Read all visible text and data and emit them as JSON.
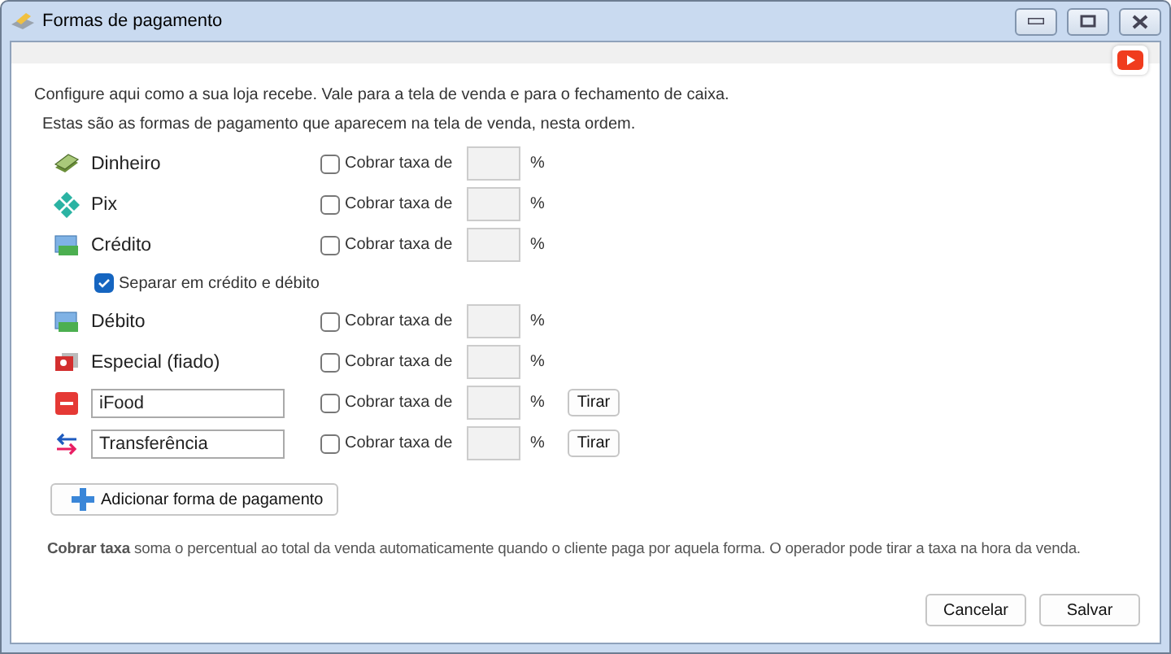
{
  "window": {
    "title": "Formas de pagamento"
  },
  "intro": "Configure aqui como a sua loja recebe. Vale para a tela de venda e para o fechamento de caixa.",
  "subtitle": "Estas são as formas de pagamento que aparecem na tela de venda, nesta ordem.",
  "methods": [
    {
      "kind": "fixed",
      "name": "Dinheiro",
      "fee_label": "Cobrar taxa de",
      "fee_checked": false,
      "unit": "%"
    },
    {
      "kind": "fixed",
      "name": "Pix",
      "fee_label": "Cobrar taxa de",
      "fee_checked": false,
      "unit": "%"
    },
    {
      "kind": "fixed",
      "name": "Crédito",
      "fee_label": "Cobrar taxa de",
      "fee_checked": false,
      "unit": "%",
      "option": {
        "label": "Separar em crédito e débito",
        "checked": true
      }
    },
    {
      "kind": "fixed",
      "name": "Débito",
      "fee_label": "Cobrar taxa de",
      "fee_checked": false,
      "unit": "%"
    },
    {
      "kind": "fixed",
      "name": "Especial (fiado)",
      "fee_label": "Cobrar taxa de",
      "fee_checked": false,
      "unit": "%"
    },
    {
      "kind": "custom",
      "name": "iFood",
      "fee_label": "Cobrar taxa de",
      "fee_checked": false,
      "unit": "%",
      "remove": "Tirar"
    },
    {
      "kind": "custom",
      "name": "Transferência",
      "fee_label": "Cobrar taxa de",
      "fee_checked": false,
      "unit": "%",
      "remove": "Tirar"
    }
  ],
  "add_button": "Adicionar forma de pagamento",
  "note": "**Cobrar taxa** soma o percentual ao total da venda automaticamente quando o cliente paga por aquela forma. O operador pode tirar a taxa na hora da venda.",
  "buttons": [
    "Cancelar",
    "Salvar"
  ]
}
